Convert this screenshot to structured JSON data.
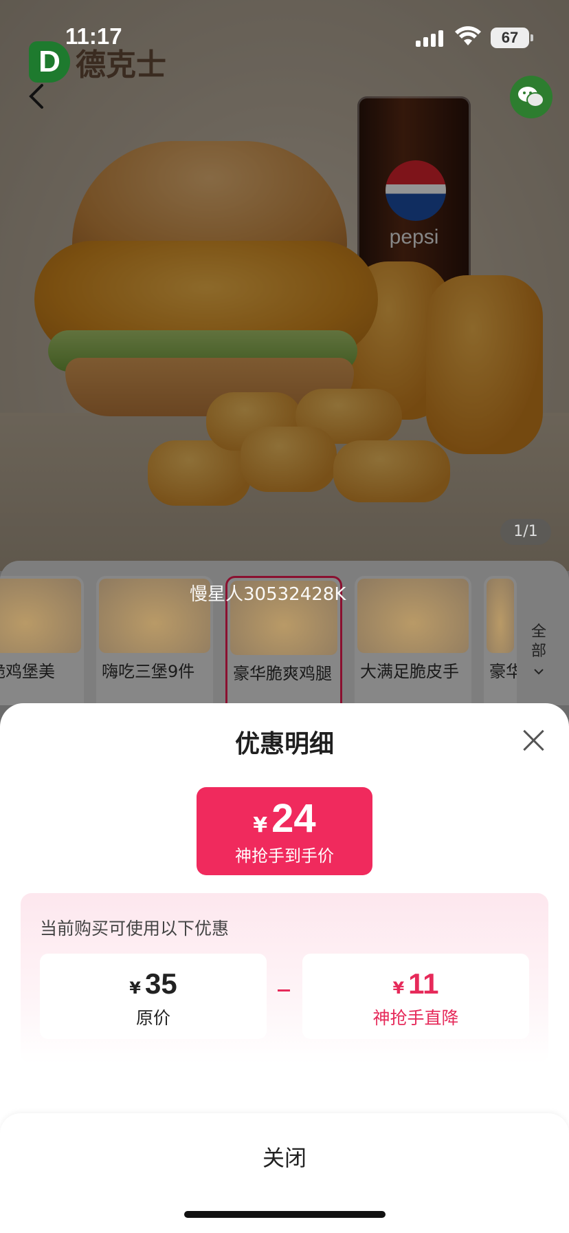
{
  "status_bar": {
    "time": "11:17",
    "battery": "67"
  },
  "hero": {
    "brand_logo": "D",
    "brand_name": "德克士",
    "cup_brand": "pepsi",
    "pager": "1/1"
  },
  "product_strip": {
    "items": [
      {
        "name": "酥脆鸡堡美"
      },
      {
        "name": "嗨吃三堡9件"
      },
      {
        "name": "豪华脆爽鸡腿"
      },
      {
        "name": "大满足脆皮手"
      },
      {
        "name": "豪华"
      }
    ],
    "all_label_1": "全",
    "all_label_2": "部"
  },
  "watermark": "慢星人30532428K",
  "sheet": {
    "title": "优惠明细",
    "final_price": {
      "currency": "¥",
      "amount": "24",
      "label": "神抢手到手价"
    },
    "promo": {
      "title": "当前购买可使用以下优惠",
      "original": {
        "currency": "¥",
        "amount": "35",
        "label": "原价"
      },
      "discount": {
        "currency": "¥",
        "amount": "11",
        "label": "神抢手直降"
      }
    },
    "close_label": "关闭"
  },
  "colors": {
    "accent": "#f02a5d",
    "discount_text": "#e62a5a",
    "brand_green": "#1e7a2e"
  },
  "icons": {
    "back": "chevron-left-icon",
    "share": "wechat-icon",
    "close": "close-icon"
  }
}
